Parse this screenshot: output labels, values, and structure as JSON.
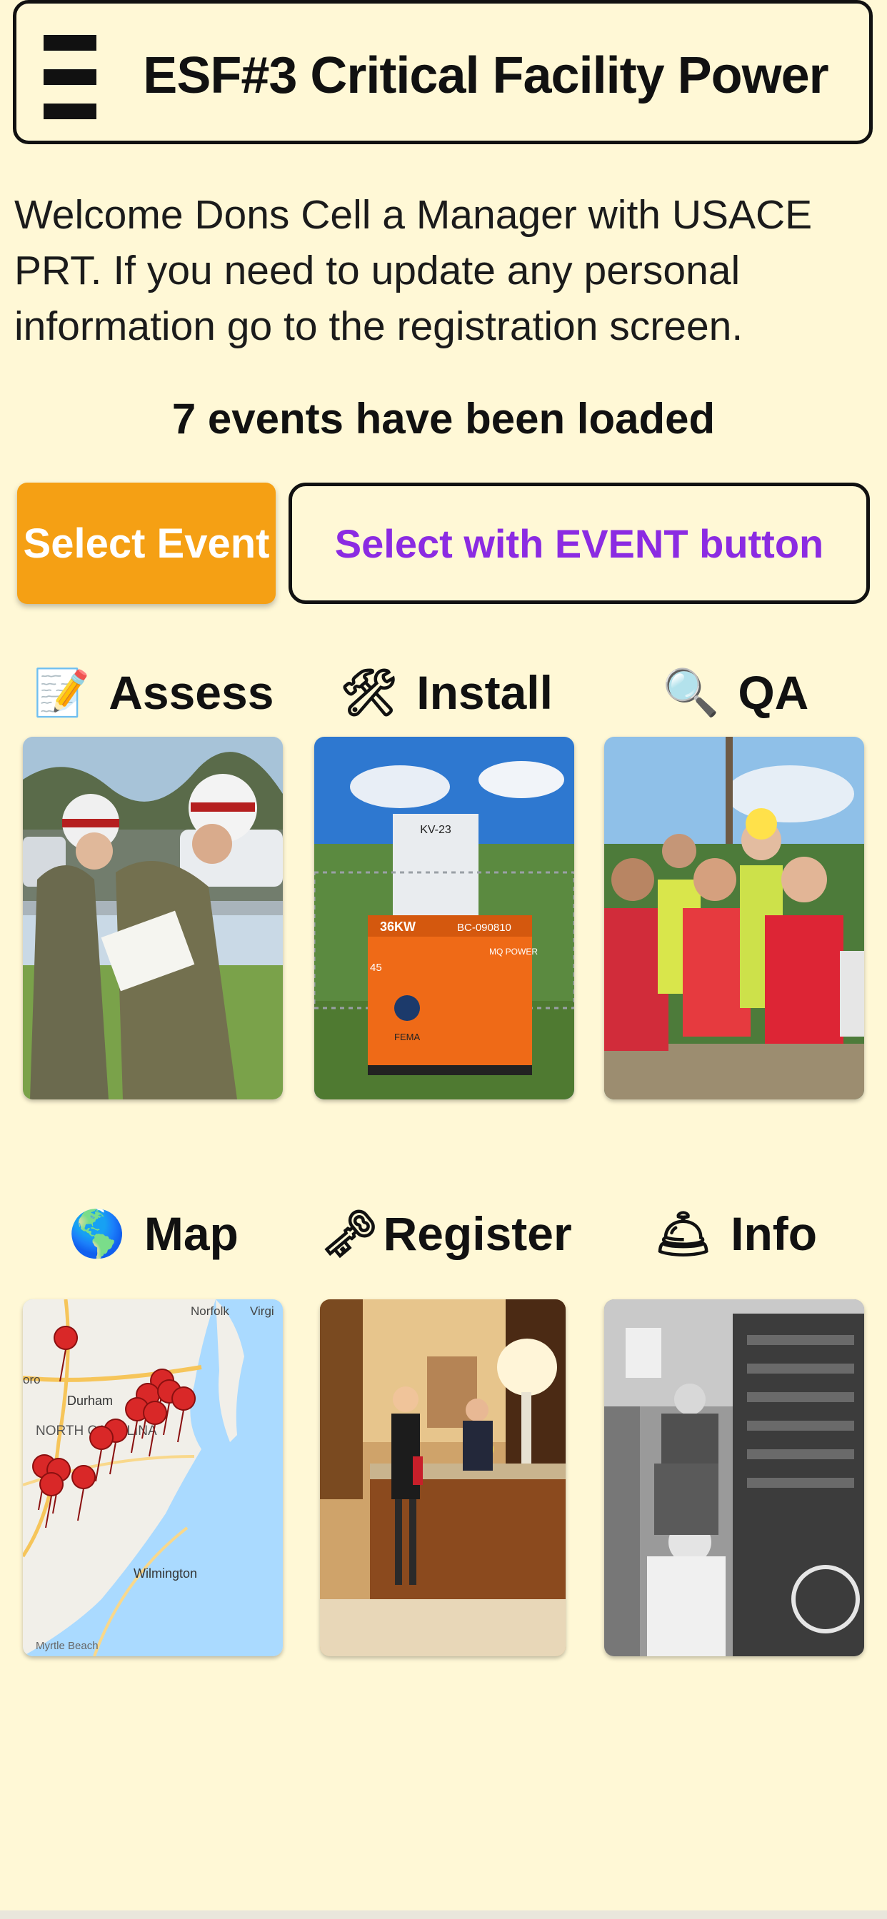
{
  "header": {
    "title": "ESF#3 Critical Facility Power",
    "menu_icon": "hamburger-menu-icon"
  },
  "welcome_text": "Welcome Dons Cell a Manager with USACE PRT.  If you need to update any personal information go to the registration screen.",
  "events_loaded_text": "7 events have been loaded",
  "buttons": {
    "select_event": "Select Event",
    "select_with_event": "Select with EVENT button"
  },
  "colors": {
    "background": "#fff8d6",
    "accent_orange": "#f5a014",
    "accent_purple": "#8b2be2"
  },
  "tiles": [
    {
      "label": "Assess",
      "icon": "memo-icon",
      "emoji": "📝"
    },
    {
      "label": "Install",
      "icon": "tools-icon",
      "emoji": "🛠"
    },
    {
      "label": "QA",
      "icon": "magnifier-icon",
      "emoji": "🔍"
    },
    {
      "label": "Map",
      "icon": "globe-icon",
      "emoji": "🌎"
    },
    {
      "label": "Register",
      "icon": "key-icon",
      "emoji": "🗝"
    },
    {
      "label": "Info",
      "icon": "bell-icon",
      "emoji": "🛎"
    }
  ],
  "map_labels": {
    "norfolk": "Norfolk",
    "virginia_beach": "Virgi",
    "durham": "Durham",
    "raleigh": "oro",
    "state": "NORTH CAROLINA",
    "wilmington": "Wilmington",
    "myrtle_beach": "Myrtle Beach"
  },
  "photo_text": {
    "sign": "KV-23",
    "generator_kw": "36KW",
    "generator_id": "BC-090810",
    "generator_brand": "MQ POWER",
    "fema": "FEMA",
    "side_number": "45"
  }
}
